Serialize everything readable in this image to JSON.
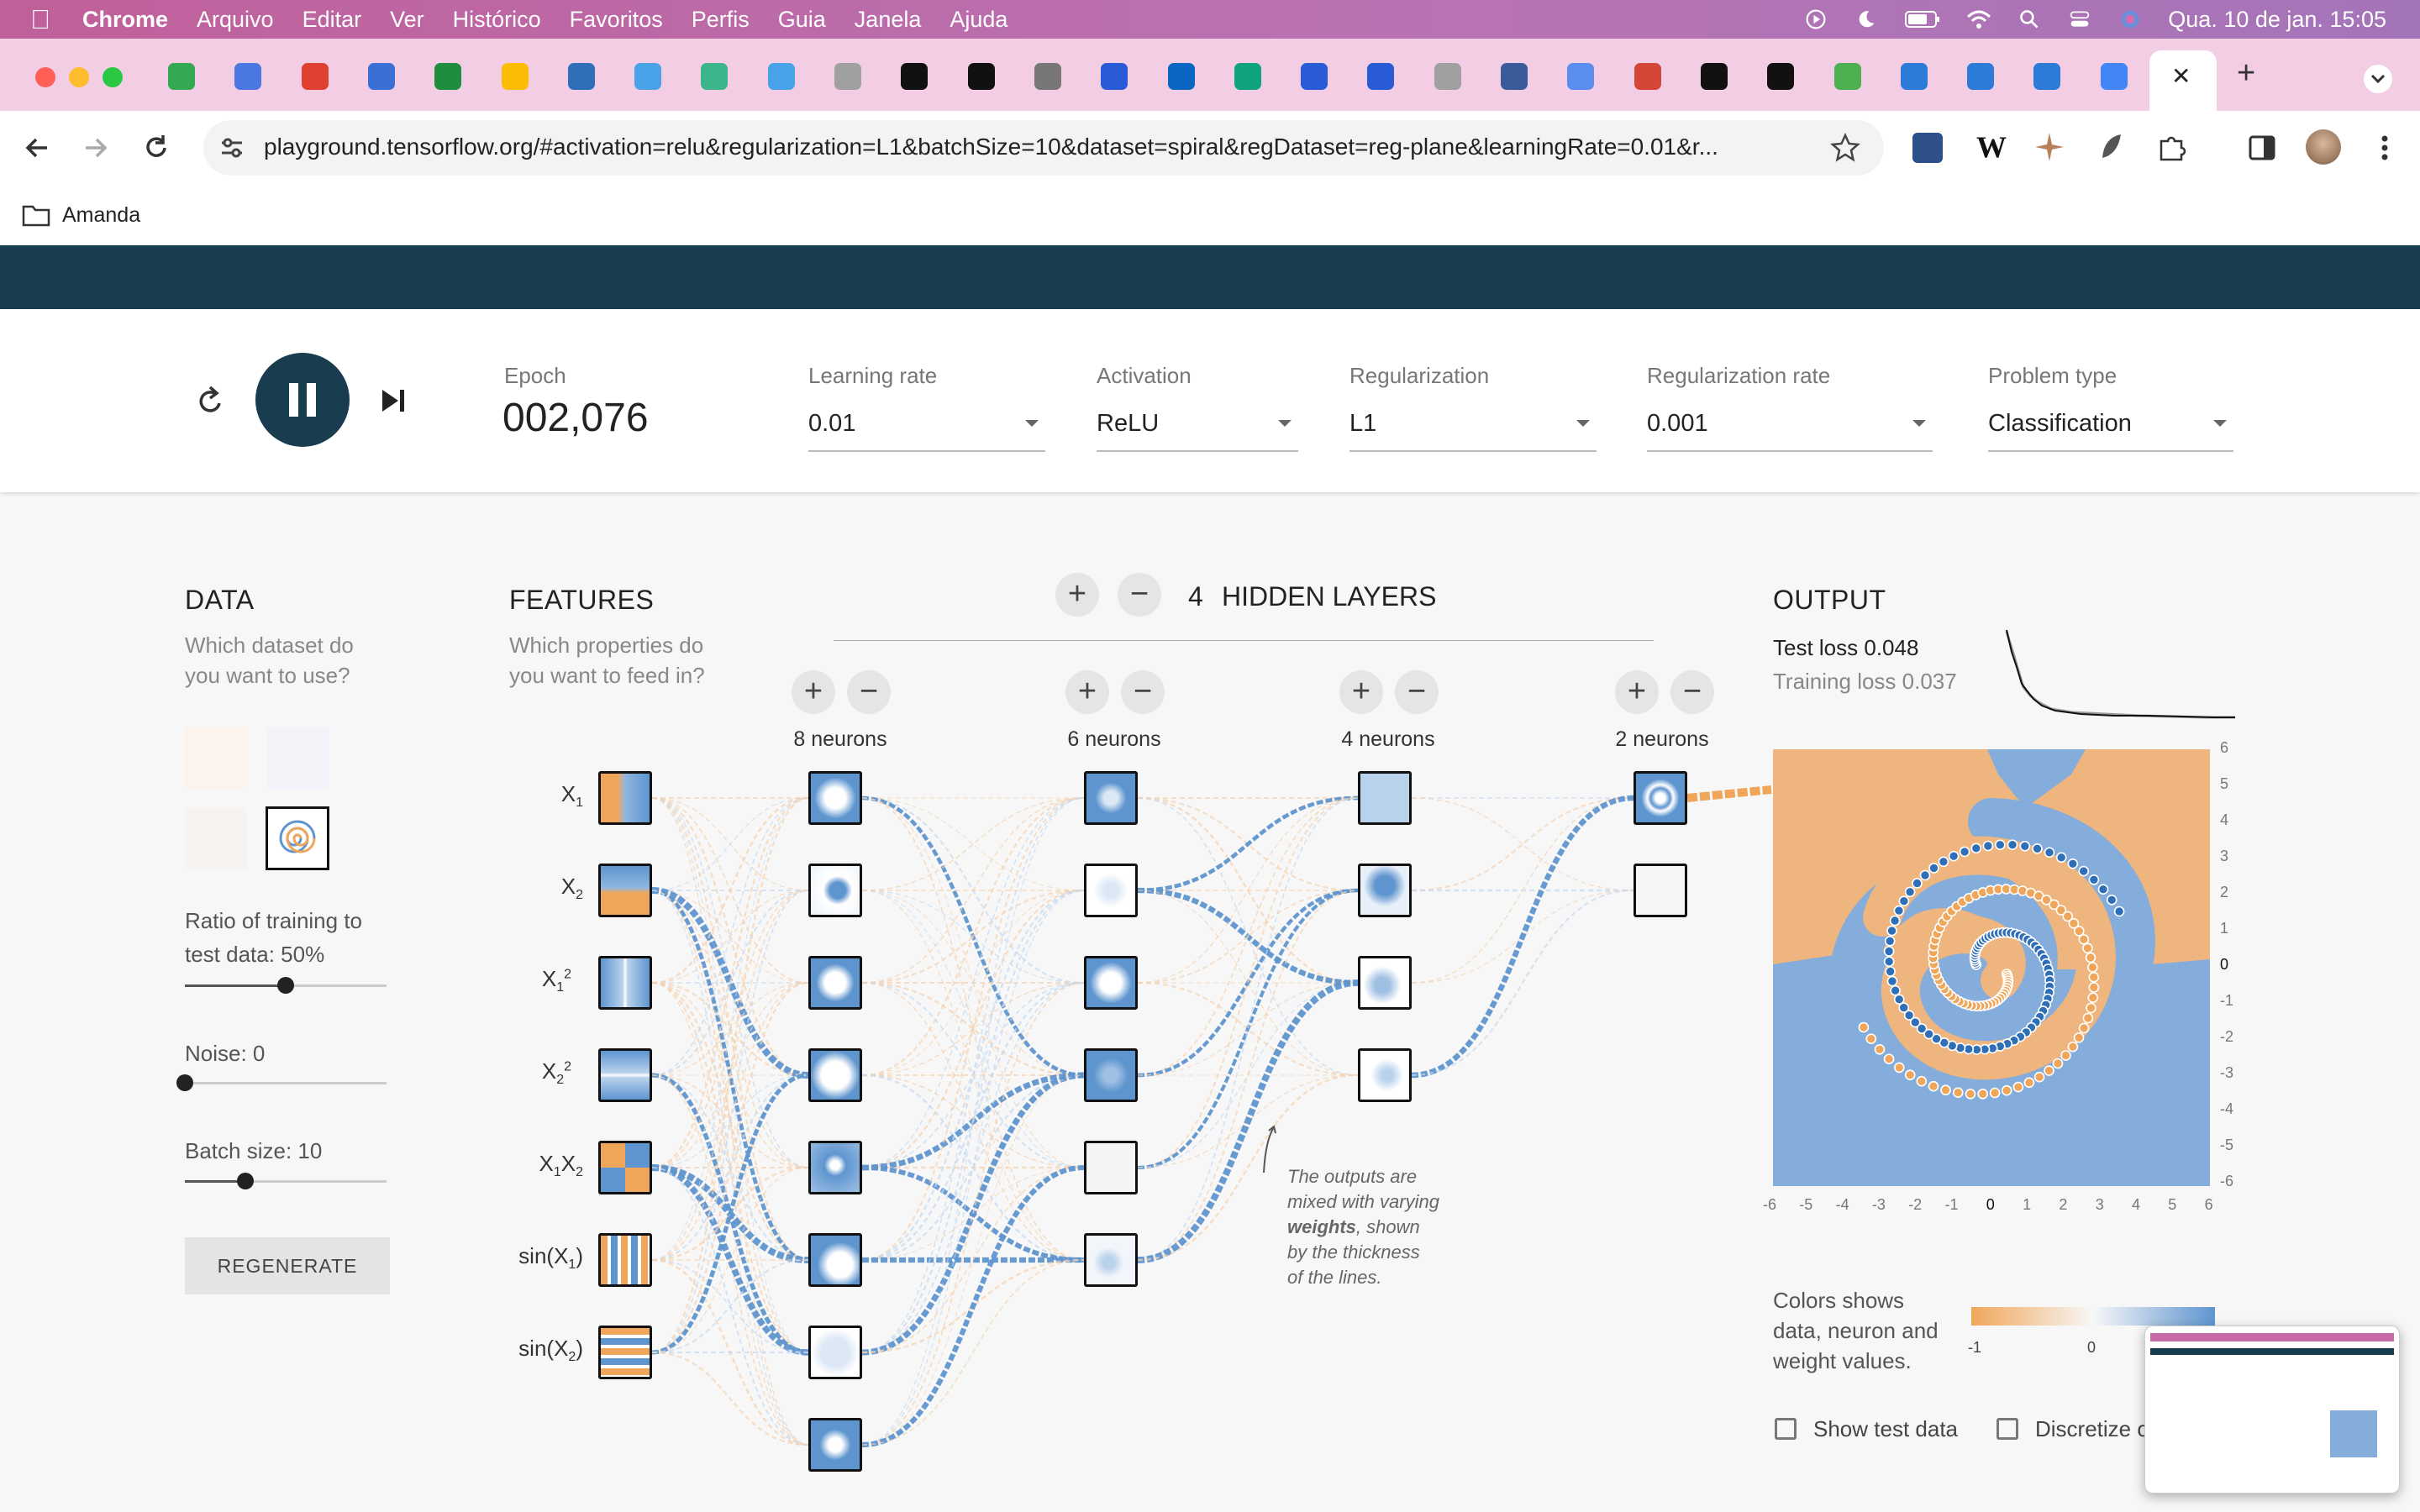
{
  "menubar": {
    "app": "Chrome",
    "items": [
      "Arquivo",
      "Editar",
      "Ver",
      "Histórico",
      "Favoritos",
      "Perfis",
      "Guia",
      "Janela",
      "Ajuda"
    ],
    "datetime": "Qua. 10 de jan.  15:05"
  },
  "browser": {
    "url": "playground.tensorflow.org/#activation=relu&regularization=L1&batchSize=10&dataset=spiral&regDataset=reg-plane&learningRate=0.01&r...",
    "bookmark_folder": "Amanda",
    "active_tab_close": "✕",
    "new_tab": "+"
  },
  "controls": {
    "epoch_label": "Epoch",
    "epoch_value": "002,076",
    "learning_rate_label": "Learning rate",
    "learning_rate_value": "0.01",
    "activation_label": "Activation",
    "activation_value": "ReLU",
    "regularization_label": "Regularization",
    "regularization_value": "L1",
    "reg_rate_label": "Regularization rate",
    "reg_rate_value": "0.001",
    "problem_type_label": "Problem type",
    "problem_type_value": "Classification"
  },
  "data_panel": {
    "title": "DATA",
    "subtitle_line1": "Which dataset do",
    "subtitle_line2": "you want to use?",
    "ratio_label_line1": "Ratio of training to",
    "ratio_label_line2": "test data:  50%",
    "ratio_value": 0.5,
    "noise_label": "Noise:  0",
    "noise_value": 0,
    "batch_label": "Batch size:  10",
    "batch_value": 0.3,
    "regenerate": "REGENERATE"
  },
  "features_panel": {
    "title": "FEATURES",
    "subtitle_line1": "Which properties do",
    "subtitle_line2": "you want to feed in?",
    "features": [
      "X1",
      "X2",
      "X1²",
      "X2²",
      "X1X2",
      "sin(X1)",
      "sin(X2)"
    ]
  },
  "network": {
    "layers_count": "4",
    "layers_label": "HIDDEN LAYERS",
    "layer_neurons": [
      "8 neurons",
      "6 neurons",
      "4 neurons",
      "2 neurons"
    ],
    "annotation_line1": "The outputs are",
    "annotation_line2": "mixed with varying",
    "annotation_bold": "weights",
    "annotation_line3": ", shown",
    "annotation_line4": "by the thickness",
    "annotation_line5": "of the lines."
  },
  "output_panel": {
    "title": "OUTPUT",
    "test_loss": "Test loss 0.048",
    "training_loss": "Training loss 0.037",
    "y_ticks": [
      "6",
      "5",
      "4",
      "3",
      "2",
      "1",
      "0",
      "-1",
      "-2",
      "-3",
      "-4",
      "-5",
      "-6"
    ],
    "x_ticks": [
      "-6",
      "-5",
      "-4",
      "-3",
      "-2",
      "-1",
      "0",
      "1",
      "2",
      "3",
      "4",
      "5",
      "6"
    ],
    "legend_line1": "Colors shows",
    "legend_line2": "data, neuron and",
    "legend_line3": "weight values.",
    "legend_min": "-1",
    "legend_mid": "0",
    "show_test_data": "Show test data",
    "discretize": "Discretize o"
  },
  "colors": {
    "orange": "#f0a65a",
    "blue": "#5e95cf",
    "header": "#183d4e"
  }
}
